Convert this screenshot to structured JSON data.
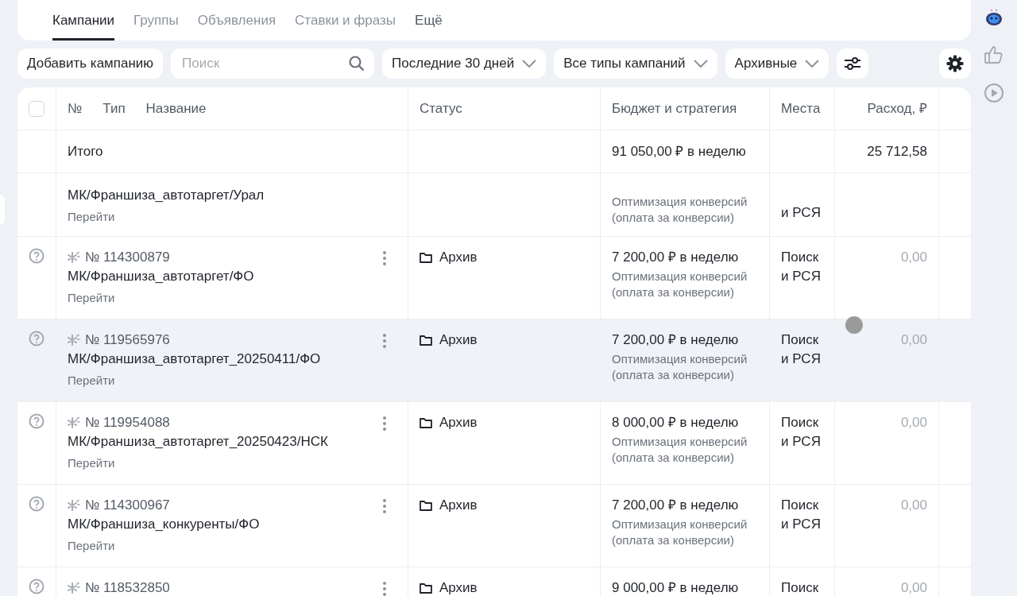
{
  "tabs": [
    {
      "label": "Кампании",
      "selected": true,
      "kind": "tab"
    },
    {
      "label": "Группы",
      "selected": false,
      "kind": "tab"
    },
    {
      "label": "Объявления",
      "selected": false,
      "kind": "tab"
    },
    {
      "label": "Ставки и фразы",
      "selected": false,
      "kind": "tab"
    },
    {
      "label": "Ещё",
      "selected": false,
      "kind": "more"
    }
  ],
  "toolbar": {
    "add_button": "Добавить кампанию",
    "search": {
      "placeholder": "Поиск"
    },
    "filters": [
      "Последние 30 дней",
      "Все типы кампаний",
      "Архивные"
    ]
  },
  "table": {
    "select_all": {
      "checked": false
    },
    "columns": [
      "№",
      "Тип",
      "Название",
      "Статус",
      "Бюджет и стратегия",
      "Места",
      "Расход, ₽"
    ],
    "totals": {
      "label": "Итого",
      "budget": "91 050,00 ₽ в неделю",
      "spend": "25 712,58"
    },
    "rows": [
      {
        "name": "МК/Франшиза_автотаргет/Урал",
        "link": "Перейти",
        "strategy": "Оптимизация конверсий (оплата за конверсии)",
        "places": "и РСЯ",
        "highlighted": false
      },
      {
        "number": "№ 114300879",
        "name": "МК/Франшиза_автотаргет/ФО",
        "link": "Перейти",
        "status": "Архив",
        "budget": "7 200,00 ₽ в неделю",
        "strategy": "Оптимизация конверсий (оплата за конверсии)",
        "places": "Поиск и РСЯ",
        "spend": "0,00",
        "highlighted": false
      },
      {
        "number": "№ 119565976",
        "name": "МК/Франшиза_автотаргет_20250411/ФО",
        "link": "Перейти",
        "status": "Архив",
        "budget": "7 200,00 ₽ в неделю",
        "strategy": "Оптимизация конверсий (оплата за конверсии)",
        "places": "Поиск и РСЯ",
        "spend": "0,00",
        "highlighted": true
      },
      {
        "number": "№ 119954088",
        "name": "МК/Франшиза_автотаргет_20250423/НСК",
        "link": "Перейти",
        "status": "Архив",
        "budget": "8 000,00 ₽ в неделю",
        "strategy": "Оптимизация конверсий (оплата за конверсии)",
        "places": "Поиск и РСЯ",
        "spend": "0,00",
        "highlighted": false
      },
      {
        "number": "№ 114300967",
        "name": "МК/Франшиза_конкуренты/ФО",
        "link": "Перейти",
        "status": "Архив",
        "budget": "7 200,00 ₽ в неделю",
        "strategy": "Оптимизация конверсий (оплата за конверсии)",
        "places": "Поиск и РСЯ",
        "spend": "0,00",
        "highlighted": false
      },
      {
        "number": "№ 118532850",
        "status": "Архив",
        "budget": "9 000,00 ₽ в неделю",
        "places": "Поиск",
        "spend": "0,00",
        "highlighted": false
      }
    ]
  }
}
